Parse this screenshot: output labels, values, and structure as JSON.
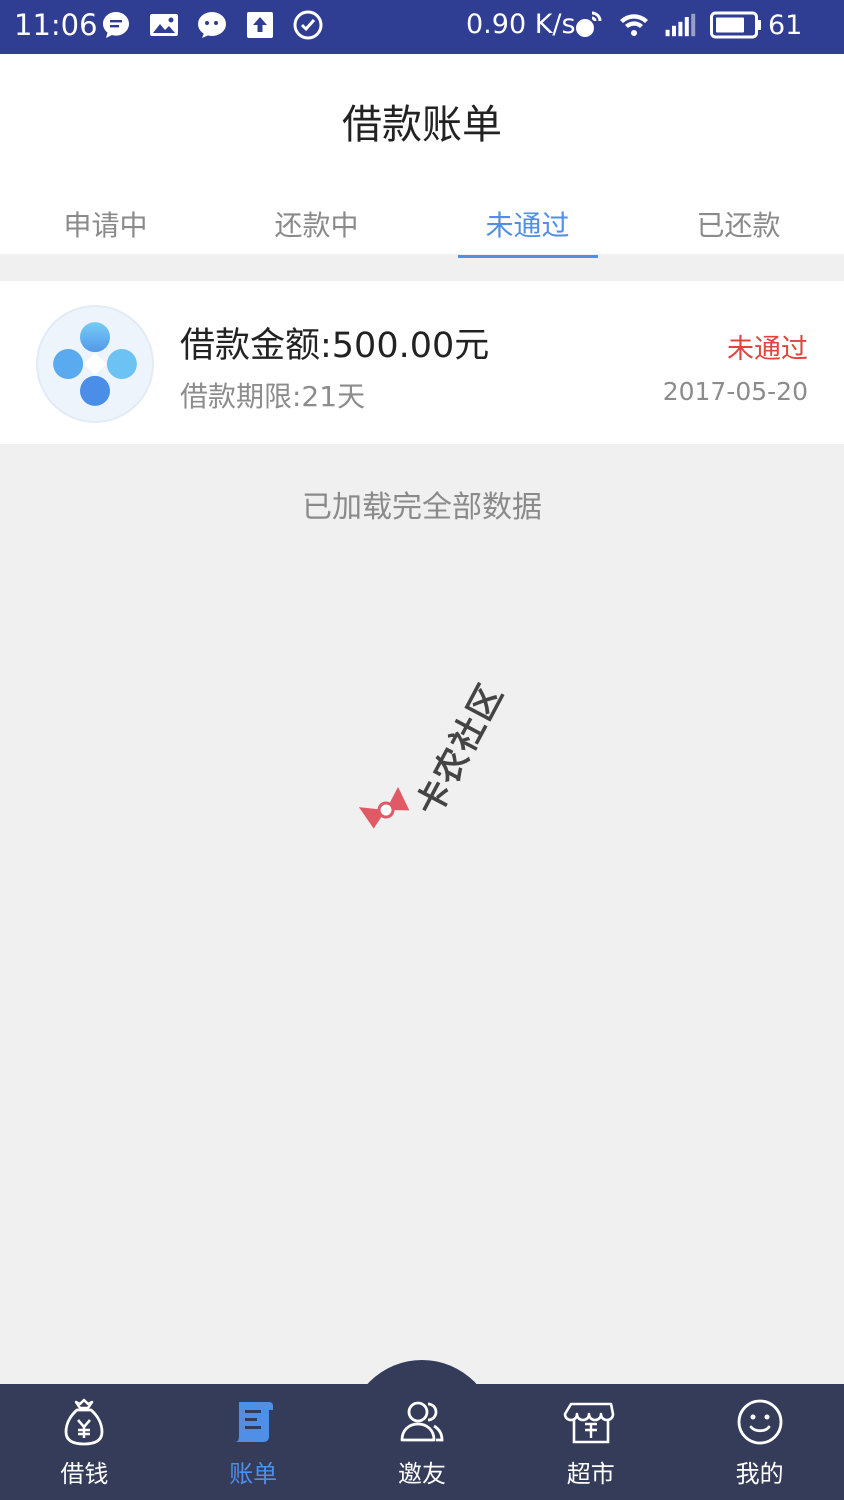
{
  "status_bar": {
    "time": "11:06",
    "speed": "0.90 K/s",
    "battery": "61"
  },
  "header": {
    "title": "借款账单"
  },
  "tabs": [
    {
      "label": "申请中",
      "active": false
    },
    {
      "label": "还款中",
      "active": false
    },
    {
      "label": "未通过",
      "active": true
    },
    {
      "label": "已还款",
      "active": false
    }
  ],
  "loan": {
    "amount": "借款金额:500.00元",
    "term": "借款期限:21天",
    "status": "未通过",
    "date": "2017-05-20"
  },
  "list_footer": "已加载完全部数据",
  "watermark": "卡农社区",
  "bottom_nav": [
    {
      "label": "借钱",
      "icon": "money-bag-icon",
      "active": false
    },
    {
      "label": "账单",
      "icon": "bill-icon",
      "active": true
    },
    {
      "label": "邀友",
      "icon": "invite-friends-icon",
      "active": false
    },
    {
      "label": "超市",
      "icon": "market-icon",
      "active": false
    },
    {
      "label": "我的",
      "icon": "smile-face-icon",
      "active": false
    }
  ],
  "colors": {
    "status_bar": "#2f3d93",
    "accent": "#4f8fe6",
    "rejected": "#e0443e",
    "nav_bg": "#353c5a"
  }
}
